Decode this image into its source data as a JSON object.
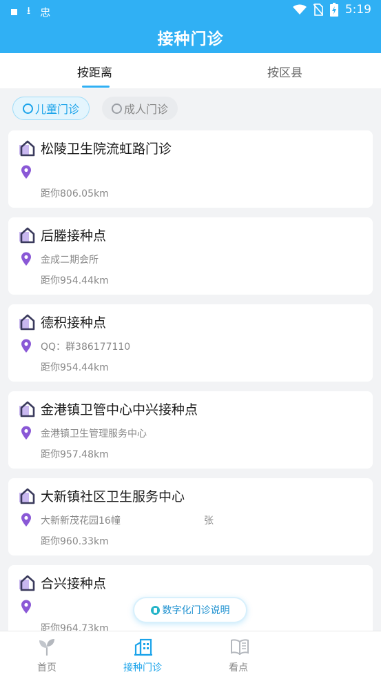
{
  "status_bar": {
    "time": "5:19",
    "app_glyph": "忠"
  },
  "header": {
    "title": "接种门诊"
  },
  "tabs": [
    {
      "label": "按距离",
      "active": true
    },
    {
      "label": "按区县",
      "active": false
    }
  ],
  "filters": [
    {
      "label": "儿童门诊",
      "active": true
    },
    {
      "label": "成人门诊",
      "active": false
    }
  ],
  "clinics": [
    {
      "name": "松陵卫生院流虹路门诊",
      "address": "",
      "address_extra": "",
      "distance": "距你806.05km"
    },
    {
      "name": "后塍接种点",
      "address": "金成二期会所",
      "address_extra": "",
      "distance": "距你954.44km"
    },
    {
      "name": "德积接种点",
      "address": "QQ：群386177110",
      "address_extra": "",
      "distance": "距你954.44km"
    },
    {
      "name": "金港镇卫管中心中兴接种点",
      "address": "金港镇卫生管理服务中心",
      "address_extra": "",
      "distance": "距你957.48km"
    },
    {
      "name": "大新镇社区卫生服务中心",
      "address": "大新新茂花园16幢",
      "address_extra": "张",
      "distance": "距你960.33km"
    },
    {
      "name": "合兴接种点",
      "address": "",
      "address_extra": "",
      "distance": "距你964.73km"
    }
  ],
  "float_button": {
    "label": "数字化门诊说明"
  },
  "bottom_nav": [
    {
      "label": "首页",
      "icon": "sprout-icon",
      "active": false
    },
    {
      "label": "接种门诊",
      "icon": "building-icon",
      "active": true
    },
    {
      "label": "看点",
      "icon": "book-icon",
      "active": false
    }
  ],
  "colors": {
    "accent": "#30b0f4",
    "pin": "#8a58d6",
    "house": "#3a3a5c"
  }
}
